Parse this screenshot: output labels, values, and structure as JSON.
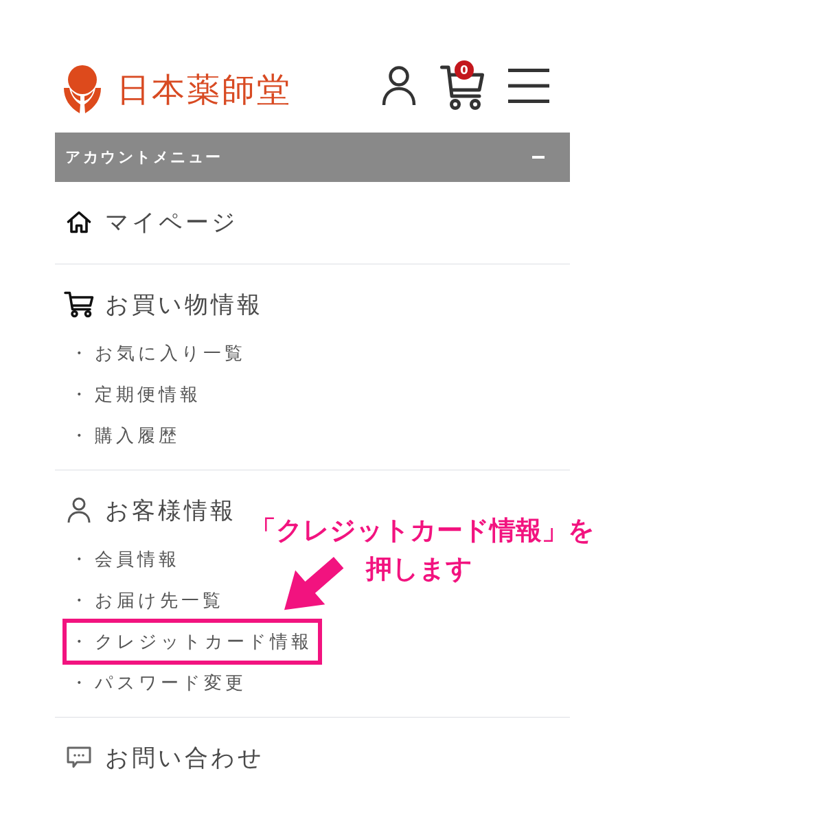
{
  "header": {
    "logo_text": "日本薬師堂",
    "cart_count": "0"
  },
  "account_menu": {
    "title": "アカウントメニュー",
    "expanded": true
  },
  "sections": [
    {
      "title": "マイページ"
    },
    {
      "title": "お買い物情報",
      "items": [
        {
          "bullet": "・",
          "label": "お気に入り一覧",
          "highlighted": false
        },
        {
          "bullet": "・",
          "label": "定期便情報",
          "highlighted": false
        },
        {
          "bullet": "・",
          "label": "購入履歴",
          "highlighted": false
        }
      ]
    },
    {
      "title": "お客様情報",
      "items": [
        {
          "bullet": "・",
          "label": "会員情報",
          "highlighted": false
        },
        {
          "bullet": "・",
          "label": "お届け先一覧",
          "highlighted": false
        },
        {
          "bullet": "・",
          "label": "クレジットカード情報",
          "highlighted": true
        },
        {
          "bullet": "・",
          "label": "パスワード変更",
          "highlighted": false
        }
      ]
    },
    {
      "title": "お問い合わせ"
    }
  ],
  "callout": {
    "lines": [
      "「クレジットカード情報」を",
      "押します"
    ]
  }
}
